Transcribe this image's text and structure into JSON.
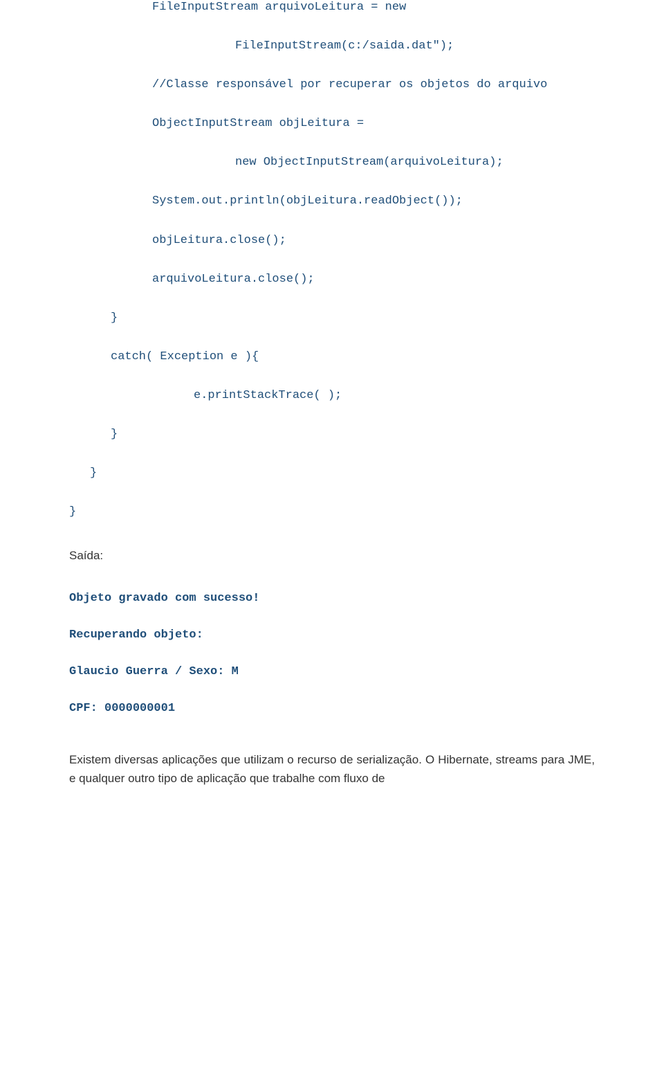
{
  "code": {
    "l1": "FileInputStream arquivoLeitura = new",
    "l2": "FileInputStream(c:/saida.dat\");",
    "l3": "//Classe responsável por recuperar os objetos do arquivo",
    "l4": "ObjectInputStream objLeitura =",
    "l5": "new ObjectInputStream(arquivoLeitura);",
    "l6": "System.out.println(objLeitura.readObject());",
    "l7": "objLeitura.close();",
    "l8": "arquivoLeitura.close();",
    "l9": "}",
    "l10": "catch( Exception e ){",
    "l11": "e.printStackTrace( );",
    "l12": "}",
    "l13": "}",
    "l14": "}"
  },
  "saida_label": "Saída:",
  "output": {
    "o1": "Objeto gravado com sucesso!",
    "o2": "Recuperando objeto:",
    "o3": "Glaucio Guerra / Sexo: M",
    "o4": "CPF: 0000000001"
  },
  "paragraph": "Existem diversas aplicações que utilizam o recurso de serialização. O Hibernate, streams para JME, e qualquer outro tipo de aplicação que trabalhe com fluxo de"
}
